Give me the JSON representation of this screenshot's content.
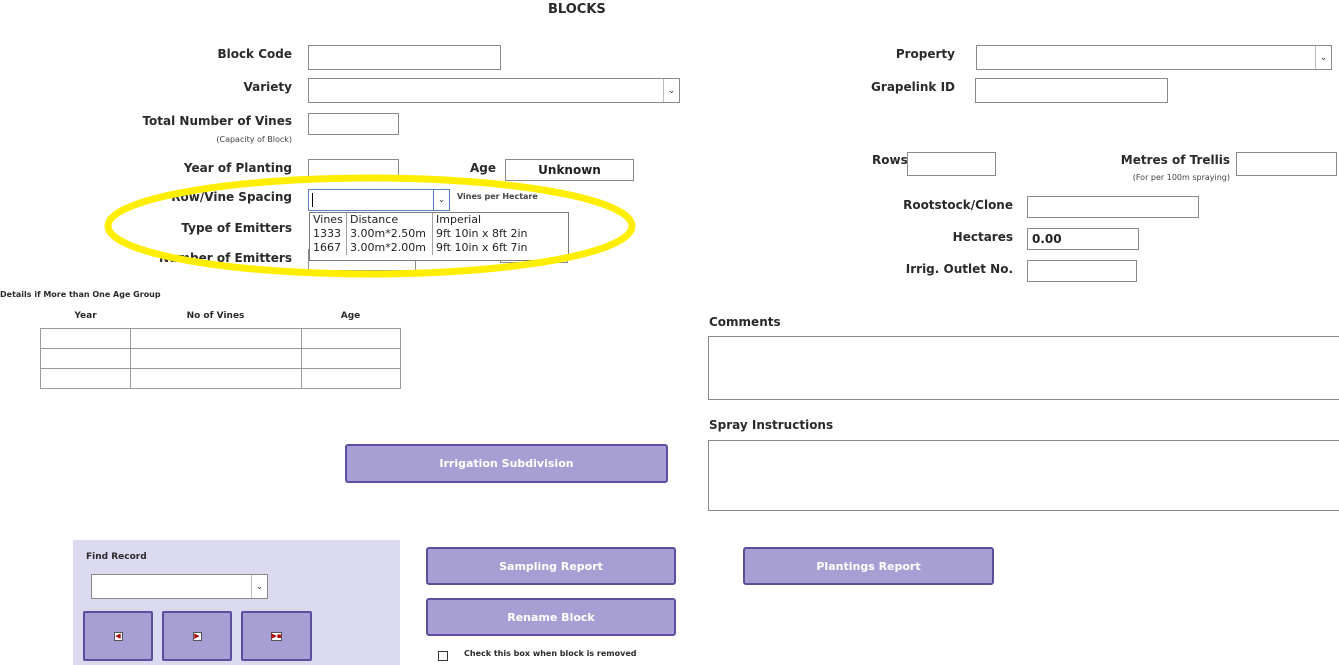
{
  "form": {
    "title": "BLOCKS"
  },
  "left": {
    "block_code_label": "Block Code",
    "variety_label": "Variety",
    "total_vines_label": "Total Number of Vines",
    "total_vines_sub": "(Capacity of Block)",
    "year_planting_label": "Year of Planting",
    "age_label": "Age",
    "age_value": "Unknown",
    "row_vine_label": "Row/Vine Spacing",
    "vines_per_hectare_label": "Vines per Hectare",
    "emitters_type_label": "Type of Emitters",
    "emitters_number_label": "Number of Emitters"
  },
  "spacing_dropdown": {
    "columns": [
      "Vines",
      "Distance",
      "Imperial"
    ],
    "rows": [
      [
        "1333",
        "3.00m*2.50m",
        "9ft 10in x 8ft 2in"
      ],
      [
        "1667",
        "3.00m*2.00m",
        "9ft 10in x 6ft 7in"
      ]
    ]
  },
  "age_groups": {
    "title": "Details if More than One Age Group",
    "headers": [
      "Year",
      "No of Vines",
      "Age"
    ]
  },
  "right": {
    "property_label": "Property",
    "grapelink_label": "Grapelink ID",
    "rows_label": "Rows",
    "trellis_label": "Metres of Trellis",
    "trellis_sub": "(For per 100m spraying)",
    "rootstock_label": "Rootstock/Clone",
    "hectares_label": "Hectares",
    "hectares_value": "0.00",
    "irrig_label": "Irrig. Outlet No.",
    "comments_label": "Comments",
    "spray_label": "Spray Instructions"
  },
  "buttons": {
    "irrigation": "Irrigation Subdivision",
    "sampling": "Sampling Report",
    "plantings": "Plantings Report",
    "rename": "Rename Block"
  },
  "find": {
    "label": "Find Record"
  },
  "removed_checkbox_label": "Check this box when block is removed",
  "highlight_color": "#ffee00",
  "accent_color": "#a79fd4"
}
